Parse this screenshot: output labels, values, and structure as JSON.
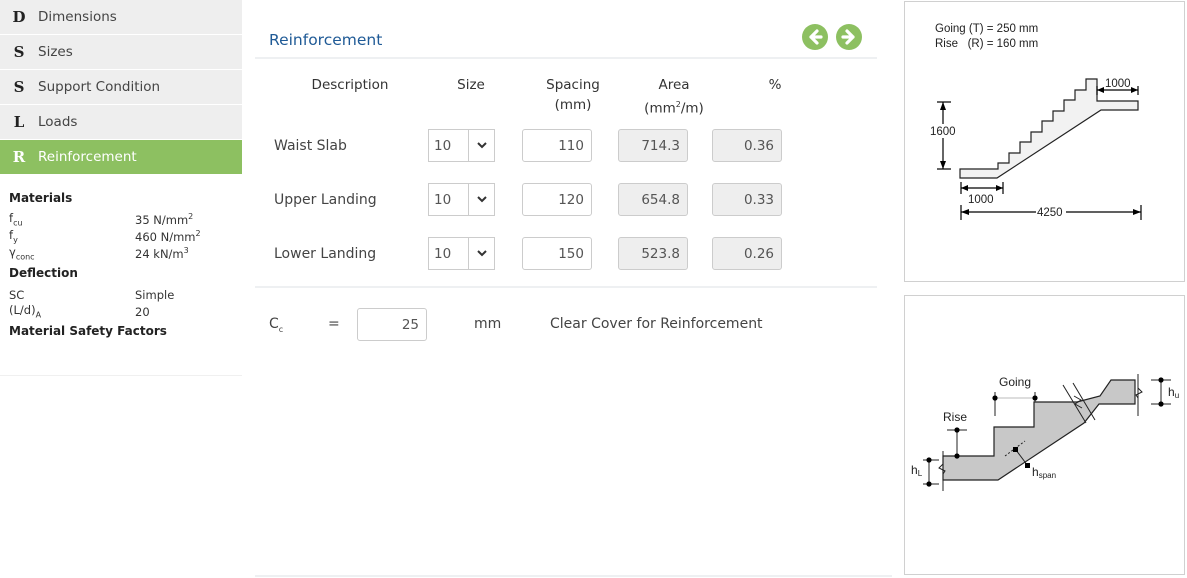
{
  "sidebar": {
    "items": [
      {
        "letter": "D",
        "label": "Dimensions",
        "active": false
      },
      {
        "letter": "S",
        "label": "Sizes",
        "active": false
      },
      {
        "letter": "S",
        "label": "Support Condition",
        "active": false
      },
      {
        "letter": "L",
        "label": "Loads",
        "active": false
      },
      {
        "letter": "R",
        "label": "Reinforcement",
        "active": true
      }
    ],
    "materials": {
      "heading": "Materials",
      "rows": [
        {
          "sym": "f",
          "sub": "cu",
          "value": "35 N/mm",
          "sup": "2"
        },
        {
          "sym": "f",
          "sub": "y",
          "value": "460 N/mm",
          "sup": "2"
        },
        {
          "sym": "γ",
          "sub": "conc",
          "value": "24 kN/m",
          "sup": "3"
        }
      ]
    },
    "deflection": {
      "heading": "Deflection",
      "rows": [
        {
          "sym": "SC",
          "sub": "",
          "value": "Simple"
        },
        {
          "sym": "(L/d)",
          "sub": "A",
          "value": "20"
        }
      ]
    },
    "safety_heading": "Material Safety Factors"
  },
  "main": {
    "title": "Reinforcement",
    "prev_icon": "arrow-left-circle-icon",
    "next_icon": "arrow-right-circle-icon",
    "headers": {
      "description": "Description",
      "size": "Size",
      "spacing_1": "Spacing",
      "spacing_2": "(mm)",
      "area_1": "Area",
      "area_2a": "(mm",
      "area_2sup": "2",
      "area_2b": "/m)",
      "percent": "%"
    },
    "rows": [
      {
        "label": "Waist Slab",
        "size": "10",
        "spacing": "110",
        "area": "714.3",
        "percent": "0.36"
      },
      {
        "label": "Upper Landing",
        "size": "10",
        "spacing": "120",
        "area": "654.8",
        "percent": "0.33"
      },
      {
        "label": "Lower Landing",
        "size": "10",
        "spacing": "150",
        "area": "523.8",
        "percent": "0.26"
      }
    ],
    "cover": {
      "symbol": "C",
      "sub": "c",
      "equals": "=",
      "value": "25",
      "unit": "mm",
      "description": "Clear Cover for Reinforcement"
    }
  },
  "diagram1": {
    "going_text": "Going (T) = 250 mm",
    "rise_text": "Rise   (R) = 160 mm",
    "upper_landing": "1000",
    "height": "1600",
    "lower_landing": "1000",
    "total_length": "4250"
  },
  "diagram2": {
    "going": "Going",
    "rise": "Rise",
    "h_u": "h",
    "h_u_sub": "u",
    "h_l": "h",
    "h_l_sub": "L",
    "h_span": "h",
    "h_span_sub": "span"
  },
  "colors": {
    "accent_green": "#8dc061",
    "title_blue": "#1f5a96",
    "readonly_bg": "#eeeeee"
  }
}
